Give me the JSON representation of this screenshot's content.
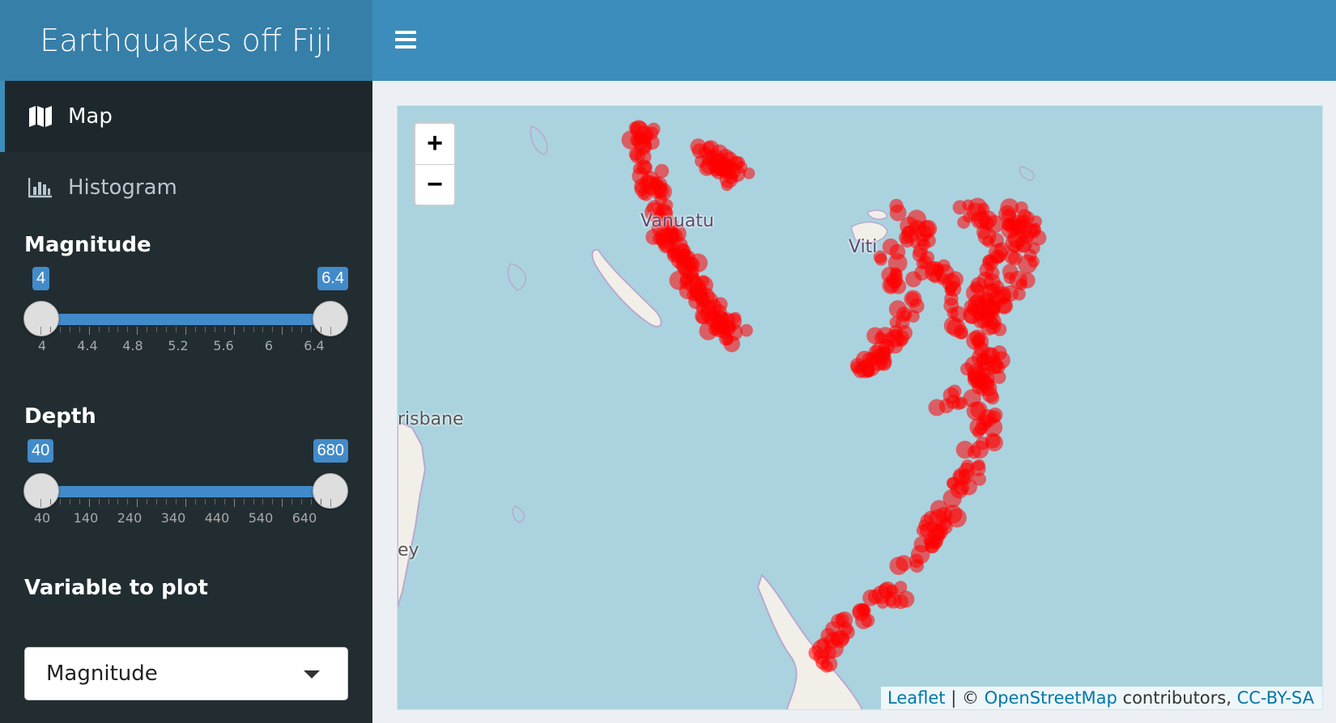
{
  "header": {
    "title": "Earthquakes off Fiji"
  },
  "sidebar": {
    "items": [
      {
        "label": "Map",
        "icon": "map-icon",
        "active": true
      },
      {
        "label": "Histogram",
        "icon": "bar-chart-icon",
        "active": false
      }
    ],
    "magnitude": {
      "label": "Magnitude",
      "from": "4",
      "to": "6.4",
      "ticks": [
        "4",
        "4.4",
        "4.8",
        "5.2",
        "5.6",
        "6",
        "6.4"
      ]
    },
    "depth": {
      "label": "Depth",
      "from": "40",
      "to": "680",
      "ticks": [
        "40",
        "140",
        "240",
        "340",
        "440",
        "540",
        "640"
      ]
    },
    "variable": {
      "label": "Variable to plot",
      "selected": "Magnitude"
    }
  },
  "map": {
    "zoom_in": "+",
    "zoom_out": "−",
    "places": {
      "vanuatu": "Vanuatu",
      "viti": "Viti",
      "brisbane": "risbane",
      "sydney": "ey"
    },
    "attribution": {
      "leaflet": "Leaflet",
      "separator": " | © ",
      "osm": "OpenStreetMap",
      "contributors": " contributors, ",
      "license": "CC-BY-SA"
    },
    "marker_color": "#ff0000"
  },
  "colors": {
    "header": "#3c8dbc",
    "logo": "#367fa9",
    "sidebar": "#222d32",
    "accent": "#428bca"
  }
}
